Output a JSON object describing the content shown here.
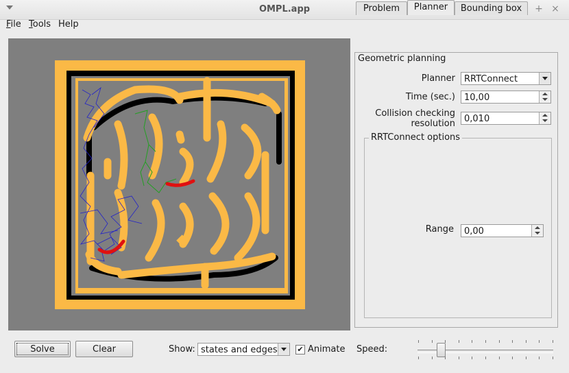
{
  "window": {
    "title": "OMPL.app"
  },
  "menu": {
    "file": "ile",
    "file_mnemonic": "F",
    "tools": "ools",
    "tools_mnemonic": "T",
    "help": "Help"
  },
  "tabs": [
    {
      "label": "Problem",
      "active": false
    },
    {
      "label": "Planner",
      "active": true
    },
    {
      "label": "Bounding box",
      "active": false
    }
  ],
  "planner_panel": {
    "section": "Geometric planning",
    "planner_label": "Planner",
    "planner_value": "RRTConnect",
    "time_label": "Time (sec.)",
    "time_value": "10,00",
    "collision_label_1": "Collision checking",
    "collision_label_2": "resolution",
    "collision_value": "0,010",
    "options_title": "RRTConnect options",
    "range_label": "Range",
    "range_value": "0,00"
  },
  "bottom": {
    "solve": "Solve",
    "clear": "Clear",
    "show_label": "Show:",
    "show_value": "states and edges",
    "animate_label": "Animate",
    "animate_checked": true,
    "speed_label": "Speed:",
    "speed_level": 0.17
  },
  "colors": {
    "maze_wall": "#fbb946",
    "maze_shadow": "#000000",
    "maze_floor": "#7f7f7f",
    "tree_start": "#2323c8",
    "tree_goal": "#22a022",
    "robot": "#e01010"
  }
}
